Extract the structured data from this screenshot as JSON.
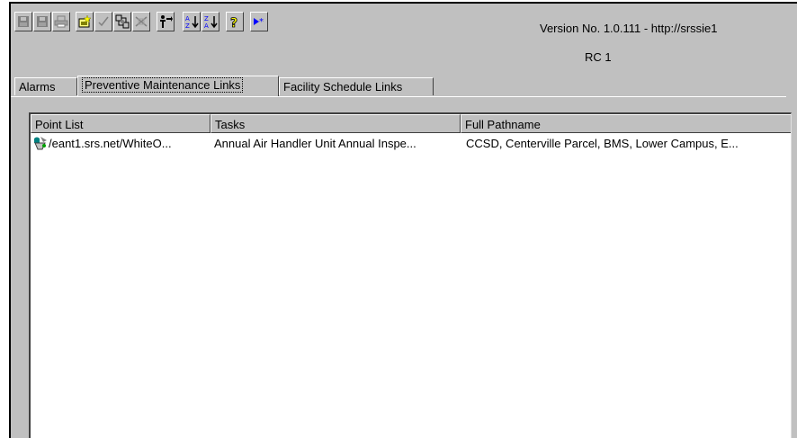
{
  "header": {
    "version_text": "Version No. 1.0.111 - http://srssie1",
    "release": "RC 1"
  },
  "toolbar": {
    "buttons": [
      {
        "icon": "disk-icon",
        "enabled": false
      },
      {
        "icon": "disk-icon",
        "enabled": false
      },
      {
        "icon": "print-icon",
        "enabled": false
      },
      {
        "icon": "new-item-icon",
        "enabled": true
      },
      {
        "icon": "checkmark-icon",
        "enabled": false
      },
      {
        "icon": "links-icon",
        "enabled": true
      },
      {
        "icon": "cancel-links-icon",
        "enabled": false
      },
      {
        "icon": "person-arrow-icon",
        "enabled": true
      },
      {
        "icon": "sort-ascending-icon",
        "enabled": true
      },
      {
        "icon": "sort-descending-icon",
        "enabled": true
      },
      {
        "icon": "help-icon",
        "enabled": true
      },
      {
        "icon": "play-star-icon",
        "enabled": true
      }
    ]
  },
  "tabs": [
    {
      "label": "Alarms"
    },
    {
      "label": "Preventive Maintenance Links",
      "active": true
    },
    {
      "label": "Facility Schedule Links"
    }
  ],
  "list": {
    "columns": [
      "Point List",
      "Tasks",
      "Full Pathname"
    ],
    "rows": [
      {
        "icon": "point-link-icon",
        "point": "/eant1.srs.net/WhiteO...",
        "task": "Annual Air Handler Unit Annual Inspe...",
        "path": "CCSD, Centerville Parcel, BMS, Lower Campus, E..."
      }
    ]
  },
  "colors": {
    "face": "#c0c0c0",
    "highlight": "#ffffff",
    "shadow": "#404040",
    "accent": "#0000ff"
  }
}
